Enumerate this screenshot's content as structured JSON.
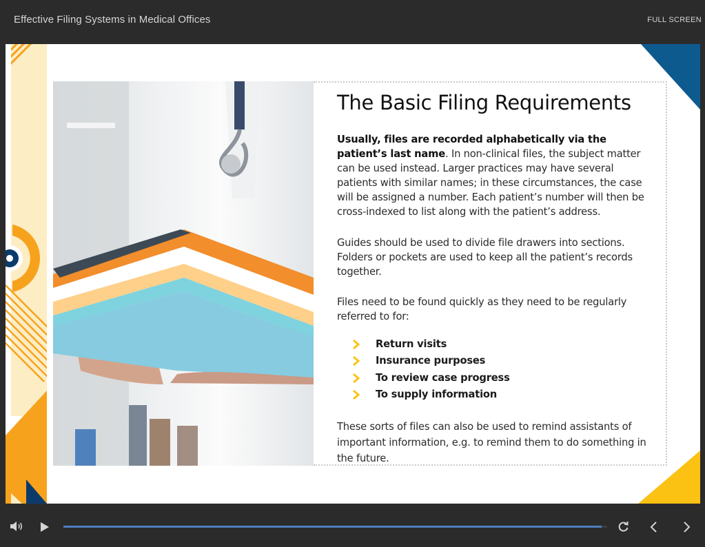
{
  "header": {
    "course_title": "Effective Filing Systems in Medical Offices",
    "fullscreen_label": "FULL SCREEN"
  },
  "slide": {
    "heading": "The Basic Filing Requirements",
    "p1_bold": "Usually, files are recorded alphabetically via the patient’s last name",
    "p1_rest": ". In non-clinical files, the subject matter can be used instead. Larger practices may have several patients with similar names; in these circumstances, the case will be assigned a number. Each patient’s number will then be cross-indexed to list along with the patient’s address.",
    "p2": "Guides should be used to divide file drawers into sections. Folders or pockets are used to keep all the patient’s records together.",
    "p3": "Files need to be found quickly as they need to be regularly referred to for:",
    "bullets": [
      "Return visits",
      "Insurance purposes",
      "To review case progress",
      "To supply information"
    ],
    "p4": "These sorts of files can also be used to remind assistants of important information, e.g. to remind them to do something in the future.",
    "colors": {
      "accent_orange": "#f7a21d",
      "accent_yellow": "#fbc214",
      "accent_navy": "#0b3b6b",
      "accent_blue": "#0d5a8f",
      "pale_yellow": "#fdedc4"
    }
  },
  "player": {
    "progress": 0.99,
    "icons": [
      "volume-icon",
      "play-icon",
      "replay-icon",
      "chevron-left-icon",
      "chevron-right-icon"
    ]
  }
}
